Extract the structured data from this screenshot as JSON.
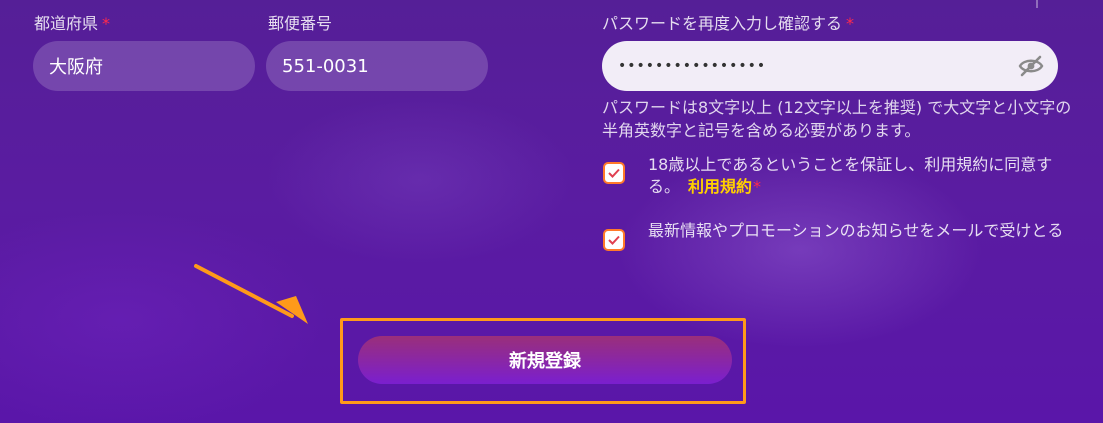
{
  "form": {
    "prefecture": {
      "label": "都道府県",
      "required_mark": "*",
      "value": "大阪府"
    },
    "postal_code": {
      "label": "郵便番号",
      "value": "551-0031"
    },
    "password_confirm": {
      "label": "パスワードを再度入力し確認する",
      "required_mark": "*",
      "value": "••••••••••••••••",
      "toggle_icon": "eye-off-icon"
    },
    "password_hint": "パスワードは8文字以上 (12文字以上を推奨) で大文字と小文字の半角英数字と記号を含める必要があります。",
    "age_terms": {
      "checked": true,
      "text": "18歳以上であるということを保証し、利用規約に同意する。",
      "link": "利用規約",
      "required_mark": "*"
    },
    "newsletter": {
      "checked": true,
      "text": "最新情報やプロモーションのお知らせをメールで受けとる"
    },
    "submit_label": "新規登録"
  },
  "colors": {
    "required": "#ff2a4d",
    "link": "#ffd000",
    "annotation": "#ff9a1a",
    "checkbox_border": "#ff7a2a"
  }
}
